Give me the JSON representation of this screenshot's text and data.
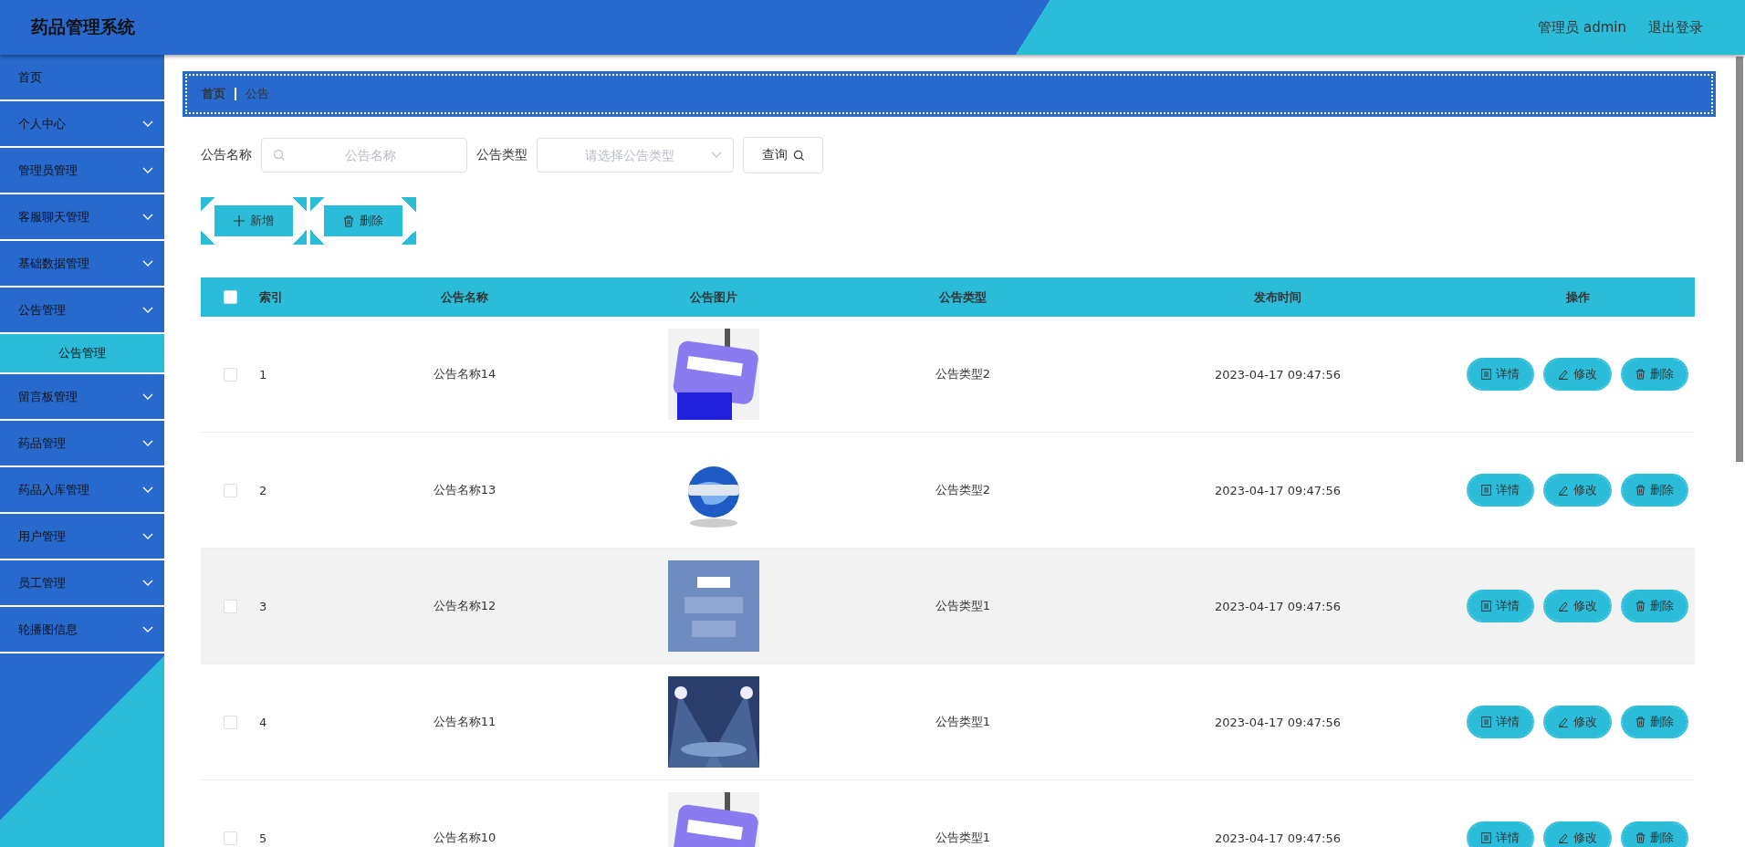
{
  "app": {
    "title": "药品管理系统"
  },
  "header": {
    "user": "管理员 admin",
    "logout": "退出登录"
  },
  "sidebar": {
    "items": [
      {
        "kind": "link",
        "label": "首页"
      },
      {
        "kind": "menu",
        "label": "个人中心"
      },
      {
        "kind": "menu",
        "label": "管理员管理"
      },
      {
        "kind": "menu",
        "label": "客服聊天管理"
      },
      {
        "kind": "menu",
        "label": "基础数据管理"
      },
      {
        "kind": "menu",
        "label": "公告管理",
        "children": [
          {
            "label": "公告管理",
            "selected": true
          }
        ]
      },
      {
        "kind": "menu",
        "label": "留言板管理"
      },
      {
        "kind": "menu",
        "label": "药品管理"
      },
      {
        "kind": "menu",
        "label": "药品入库管理"
      },
      {
        "kind": "menu",
        "label": "用户管理"
      },
      {
        "kind": "menu",
        "label": "员工管理"
      },
      {
        "kind": "menu",
        "label": "轮播图信息"
      }
    ]
  },
  "breadcrumb": [
    "首页",
    "公告"
  ],
  "filters": [
    {
      "kind": "search",
      "label": "公告名称",
      "placeholder": "公告名称"
    },
    {
      "kind": "select",
      "label": "公告类型",
      "placeholder": "请选择公告类型"
    }
  ],
  "query_button": "查询",
  "actions": [
    {
      "kind": "add",
      "label": "新增"
    },
    {
      "kind": "delete",
      "label": "删除"
    }
  ],
  "table": {
    "all_checked": false,
    "columns": [
      "索引",
      "公告名称",
      "公告图片",
      "公告类型",
      "发布时间",
      "操作"
    ],
    "rows": [
      {
        "index": "1",
        "name": "公告名称14",
        "type": "公告类型2",
        "time": "2023-04-17 09:47:56",
        "checked": false,
        "hovered": false,
        "actions": [
          {
            "kind": "detail",
            "label": "详情"
          },
          {
            "kind": "edit",
            "label": "修改"
          },
          {
            "kind": "delete",
            "label": "删除"
          }
        ]
      },
      {
        "index": "2",
        "name": "公告名称13",
        "type": "公告类型2",
        "time": "2023-04-17 09:47:56",
        "checked": false,
        "hovered": false,
        "actions": [
          {
            "kind": "detail",
            "label": "详情"
          },
          {
            "kind": "edit",
            "label": "修改"
          },
          {
            "kind": "delete",
            "label": "删除"
          }
        ]
      },
      {
        "index": "3",
        "name": "公告名称12",
        "type": "公告类型1",
        "time": "2023-04-17 09:47:56",
        "checked": false,
        "hovered": true,
        "actions": [
          {
            "kind": "detail",
            "label": "详情"
          },
          {
            "kind": "edit",
            "label": "修改"
          },
          {
            "kind": "delete",
            "label": "删除"
          }
        ]
      },
      {
        "index": "4",
        "name": "公告名称11",
        "type": "公告类型1",
        "time": "2023-04-17 09:47:56",
        "checked": false,
        "hovered": false,
        "actions": [
          {
            "kind": "detail",
            "label": "详情"
          },
          {
            "kind": "edit",
            "label": "修改"
          },
          {
            "kind": "delete",
            "label": "删除"
          }
        ]
      },
      {
        "index": "5",
        "name": "公告名称10",
        "type": "公告类型1",
        "time": "2023-04-17 09:47:56",
        "checked": false,
        "hovered": false,
        "actions": [
          {
            "kind": "detail",
            "label": "详情"
          },
          {
            "kind": "edit",
            "label": "修改"
          },
          {
            "kind": "delete",
            "label": "删除"
          }
        ]
      }
    ]
  }
}
